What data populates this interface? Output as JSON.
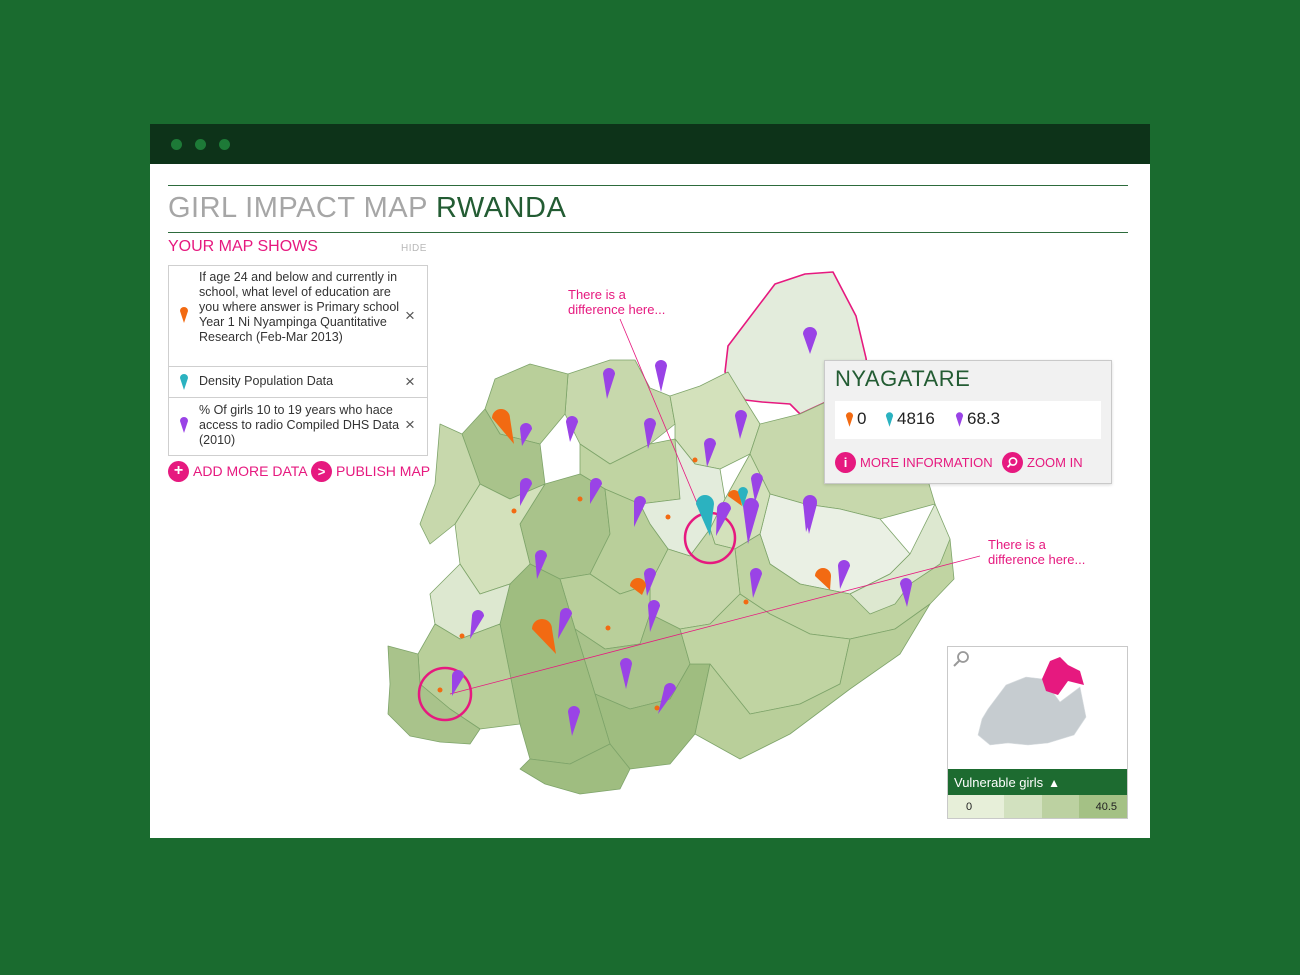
{
  "app": {
    "title_part1": "GIRL IMPACT MAP",
    "title_part2": "RWANDA"
  },
  "panel": {
    "heading": "YOUR MAP SHOWS",
    "hide_label": "HIDE",
    "legend": [
      {
        "text": "If age 24 and below and currently in school, what level of education are you where answer is Primary school Year 1 Ni Nyampinga Quantitative Research (Feb-Mar 2013)",
        "icon": "orange-pin-icon",
        "color": "#f26a12"
      },
      {
        "text": "Density Population Data",
        "icon": "teal-pin-icon",
        "color": "#2bb2c0"
      },
      {
        "text": "% Of girls 10 to 19 years who hace access to radio Compiled DHS Data (2010)",
        "icon": "purple-pin-icon",
        "color": "#9a43e6"
      }
    ],
    "add_label": "ADD MORE DATA",
    "publish_label": "PUBLISH MAP"
  },
  "annotations": [
    {
      "text": "There is a\ndifference here..."
    },
    {
      "text": "There is a\ndifference here..."
    }
  ],
  "popup": {
    "title": "NYAGATARE",
    "values": [
      "0",
      "4816",
      "68.3"
    ],
    "more_label": "MORE INFORMATION",
    "zoom_label": "ZOOM IN"
  },
  "minimap": {
    "legend_title": "Vulnerable girls",
    "scale_min": "0",
    "scale_max": "40.5"
  },
  "colors": {
    "accent": "#e6197f",
    "brand_green": "#235c33",
    "background": "#1a6b2f",
    "pin_orange": "#f26a12",
    "pin_teal": "#2bb2c0",
    "pin_purple": "#9a43e6"
  }
}
